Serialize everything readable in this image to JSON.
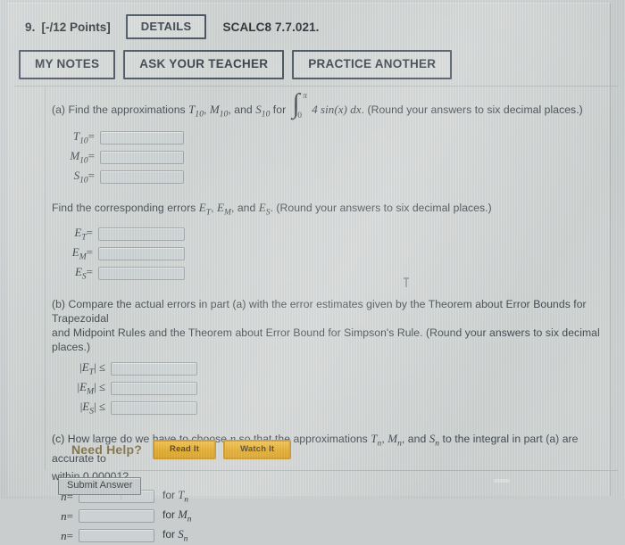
{
  "header": {
    "question_number": "9.",
    "points": "[-/12 Points]",
    "details_button": "DETAILS",
    "reference": "SCALC8 7.7.021.",
    "my_notes_button": "MY NOTES",
    "ask_teacher_button": "ASK YOUR TEACHER",
    "practice_another_button": "PRACTICE ANOTHER"
  },
  "part_a": {
    "text_1": "(a) Find the approximations ",
    "t_sym": "T",
    "t_sub": "10",
    "m_sym": "M",
    "m_sub": "10",
    "s_sym": "S",
    "s_sub": "10",
    "text_2": ", and ",
    "text_3": " for",
    "integral": {
      "lower": "0",
      "upper": "π",
      "integrand": "4 sin(x) dx"
    },
    "text_4": ". (Round your answers to six decimal places.)",
    "rows": [
      {
        "label_sym": "T",
        "label_sub": "10",
        "op": "=",
        "value": ""
      },
      {
        "label_sym": "M",
        "label_sub": "10",
        "op": "=",
        "value": ""
      },
      {
        "label_sym": "S",
        "label_sub": "10",
        "op": "=",
        "value": ""
      }
    ]
  },
  "errors": {
    "text_1": "Find the corresponding errors ",
    "e_t": "E",
    "e_t_sub": "T",
    "e_m": "E",
    "e_m_sub": "M",
    "e_s": "E",
    "e_s_sub": "S",
    "text_2": ", ",
    "text_3": ", and ",
    "text_4": ". (Round your answers to six decimal places.)",
    "rows": [
      {
        "label_sym": "E",
        "label_sub": "T",
        "op": "=",
        "value": ""
      },
      {
        "label_sym": "E",
        "label_sub": "M",
        "op": "=",
        "value": ""
      },
      {
        "label_sym": "E",
        "label_sub": "S",
        "op": "=",
        "value": ""
      }
    ]
  },
  "part_b": {
    "line_1": "(b) Compare the actual errors in part (a) with the error estimates given by the Theorem about Error Bounds for Trapezoidal",
    "line_2": "and Midpoint Rules and the Theorem about Error Bound for Simpson's Rule. (Round your answers to six decimal places.)",
    "rows": [
      {
        "label_sym": "E",
        "label_sub": "T",
        "op": "≤",
        "value": ""
      },
      {
        "label_sym": "E",
        "label_sub": "M",
        "op": "≤",
        "value": ""
      },
      {
        "label_sym": "E",
        "label_sub": "S",
        "op": "≤",
        "value": ""
      }
    ]
  },
  "part_c": {
    "line_1a": "(c) How large do we have to choose ",
    "n_sym": "n",
    "line_1b": " so that the approximations ",
    "t_sym": "T",
    "t_sub": "n",
    "m_sym": "M",
    "m_sub": "n",
    "s_sym": "S",
    "s_sub": "n",
    "line_1c": ", and ",
    "line_1d": " to the integral in part (a) are accurate to",
    "line_2": "within 0.00001?",
    "rows": [
      {
        "label_sym": "n",
        "op": "=",
        "value": "",
        "for_text": "for ",
        "for_sym": "T",
        "for_sub": "n"
      },
      {
        "label_sym": "n",
        "op": "=",
        "value": "",
        "for_text": "for ",
        "for_sym": "M",
        "for_sub": "n"
      },
      {
        "label_sym": "n",
        "op": "=",
        "value": "",
        "for_text": "for ",
        "for_sym": "S",
        "for_sub": "n"
      }
    ]
  },
  "help": {
    "label": "Need Help?",
    "read_it": "Read It",
    "watch_it": "Watch It"
  },
  "footer": {
    "submit_button": "Submit Answer"
  },
  "colors": {
    "page_background": "#cfd3d2",
    "button_border": "#3b4654",
    "help_accent": "#e2a315",
    "help_label": "#7c6a3d",
    "field_fill": "#ccd2d3",
    "text": "#353c42"
  }
}
